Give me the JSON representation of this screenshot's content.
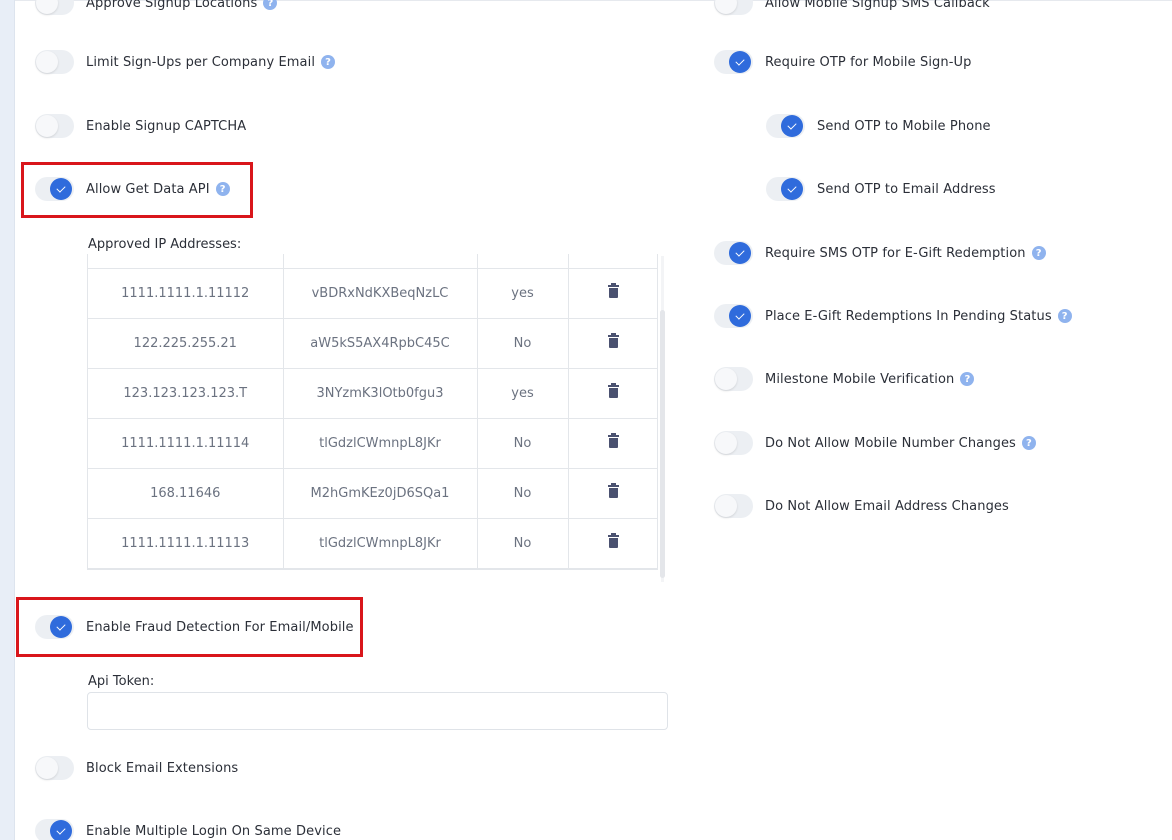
{
  "left_settings": {
    "approve_signup_locations": "Approve Signup Locations",
    "limit_signups": "Limit Sign-Ups per Company Email",
    "signup_captcha": "Enable Signup CAPTCHA",
    "allow_get_data_api": "Allow Get Data API",
    "fraud_detection": "Enable Fraud Detection For Email/Mobile",
    "block_email_extensions": "Block Email Extensions",
    "multiple_login": "Enable Multiple Login On Same Device"
  },
  "right_settings": {
    "mobile_sms_callback": "Allow Mobile Signup SMS Callback",
    "require_otp_mobile": "Require OTP for Mobile Sign-Up",
    "send_otp_phone": "Send OTP to Mobile Phone",
    "send_otp_email": "Send OTP to Email Address",
    "require_sms_otp_egift": "Require SMS OTP for E-Gift Redemption",
    "place_egift_pending": "Place E-Gift Redemptions In Pending Status",
    "milestone_mobile": "Milestone Mobile Verification",
    "no_mobile_changes": "Do Not Allow Mobile Number Changes",
    "no_email_changes": "Do Not Allow Email Address Changes"
  },
  "help_glyph": "?",
  "approved_ips": {
    "label": "Approved IP Addresses:",
    "rows": [
      {
        "ip": "1111.1111.1.11112",
        "key": "vBDRxNdKXBeqNzLC",
        "flag": "yes"
      },
      {
        "ip": "122.225.255.21",
        "key": "aW5kS5AX4RpbC45C",
        "flag": "No"
      },
      {
        "ip": "123.123.123.123.T",
        "key": "3NYzmK3lOtb0fgu3",
        "flag": "yes"
      },
      {
        "ip": "1111.1111.1.11114",
        "key": "tlGdzlCWmnpL8JKr",
        "flag": "No"
      },
      {
        "ip": "168.11646",
        "key": "M2hGmKEz0jD6SQa1",
        "flag": "No"
      },
      {
        "ip": "1111.1111.1.11113",
        "key": "tlGdzlCWmnpL8JKr",
        "flag": "No"
      }
    ]
  },
  "api_token": {
    "label": "Api Token:",
    "value": "",
    "placeholder": ""
  },
  "colors": {
    "toggle_on": "#2f6bdc",
    "toggle_off": "#eceff3",
    "highlight": "#d9161b",
    "help_badge": "#8fb3ee"
  }
}
